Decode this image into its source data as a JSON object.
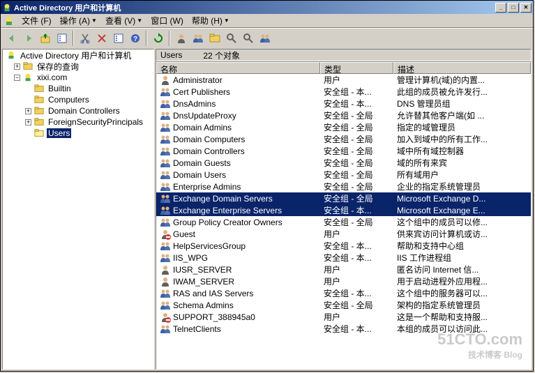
{
  "window": {
    "title": "Active Directory 用户和计算机"
  },
  "menu": {
    "file": "文件 (F)",
    "action": "操作 (A)",
    "view": "查看 (V)",
    "window": "窗口 (W)",
    "help": "帮助 (H)"
  },
  "tree": {
    "root": "Active Directory 用户和计算机",
    "saved_queries": "保存的查询",
    "domain": "xixi.com",
    "builtin": "Builtin",
    "computers": "Computers",
    "domain_controllers": "Domain Controllers",
    "fsp": "ForeignSecurityPrincipals",
    "users": "Users"
  },
  "status": {
    "container": "Users",
    "count": "22 个对象"
  },
  "columns": {
    "name": "名称",
    "type": "类型",
    "desc": "描述"
  },
  "rows": [
    {
      "name": "Administrator",
      "type": "用户",
      "desc": "管理计算机(域)的内置...",
      "icon": "user",
      "sel": false
    },
    {
      "name": "Cert Publishers",
      "type": "安全组 - 本...",
      "desc": "此组的成员被允许发行...",
      "icon": "users",
      "sel": false
    },
    {
      "name": "DnsAdmins",
      "type": "安全组 - 本...",
      "desc": "DNS 管理员组",
      "icon": "users",
      "sel": false
    },
    {
      "name": "DnsUpdateProxy",
      "type": "安全组 - 全局",
      "desc": "允许替其他客户端(如 ...",
      "icon": "users",
      "sel": false
    },
    {
      "name": "Domain Admins",
      "type": "安全组 - 全局",
      "desc": "指定的域管理员",
      "icon": "users",
      "sel": false
    },
    {
      "name": "Domain Computers",
      "type": "安全组 - 全局",
      "desc": "加入到域中的所有工作...",
      "icon": "users",
      "sel": false
    },
    {
      "name": "Domain Controllers",
      "type": "安全组 - 全局",
      "desc": "域中所有域控制器",
      "icon": "users",
      "sel": false
    },
    {
      "name": "Domain Guests",
      "type": "安全组 - 全局",
      "desc": "域的所有来宾",
      "icon": "users",
      "sel": false
    },
    {
      "name": "Domain Users",
      "type": "安全组 - 全局",
      "desc": "所有域用户",
      "icon": "users",
      "sel": false
    },
    {
      "name": "Enterprise Admins",
      "type": "安全组 - 全局",
      "desc": "企业的指定系统管理员",
      "icon": "users",
      "sel": false
    },
    {
      "name": "Exchange Domain Servers",
      "type": "安全组 - 全局",
      "desc": "Microsoft Exchange D...",
      "icon": "users",
      "sel": true
    },
    {
      "name": "Exchange Enterprise Servers",
      "type": "安全组 - 本...",
      "desc": "Microsoft Exchange E...",
      "icon": "users",
      "sel": true
    },
    {
      "name": "Group Policy Creator Owners",
      "type": "安全组 - 全局",
      "desc": "这个组中的成员可以修...",
      "icon": "users",
      "sel": false
    },
    {
      "name": "Guest",
      "type": "用户",
      "desc": "供来宾访问计算机或访...",
      "icon": "guest",
      "sel": false
    },
    {
      "name": "HelpServicesGroup",
      "type": "安全组 - 本...",
      "desc": "帮助和支持中心组",
      "icon": "users",
      "sel": false
    },
    {
      "name": "IIS_WPG",
      "type": "安全组 - 本...",
      "desc": "IIS 工作进程组",
      "icon": "users",
      "sel": false
    },
    {
      "name": "IUSR_SERVER",
      "type": "用户",
      "desc": "匿名访问 Internet 信...",
      "icon": "user",
      "sel": false
    },
    {
      "name": "IWAM_SERVER",
      "type": "用户",
      "desc": "用于启动进程外应用程...",
      "icon": "user",
      "sel": false
    },
    {
      "name": "RAS and IAS Servers",
      "type": "安全组 - 本...",
      "desc": "这个组中的服务器可以...",
      "icon": "users",
      "sel": false
    },
    {
      "name": "Schema Admins",
      "type": "安全组 - 全局",
      "desc": "架构的指定系统管理员",
      "icon": "users",
      "sel": false
    },
    {
      "name": "SUPPORT_388945a0",
      "type": "用户",
      "desc": "这是一个帮助和支持服...",
      "icon": "guest",
      "sel": false
    },
    {
      "name": "TelnetClients",
      "type": "安全组 - 本...",
      "desc": "本组的成员可以访问此...",
      "icon": "users",
      "sel": false
    }
  ],
  "watermark": {
    "main": "51CTO.com",
    "sub": "技术博客   Blog"
  }
}
